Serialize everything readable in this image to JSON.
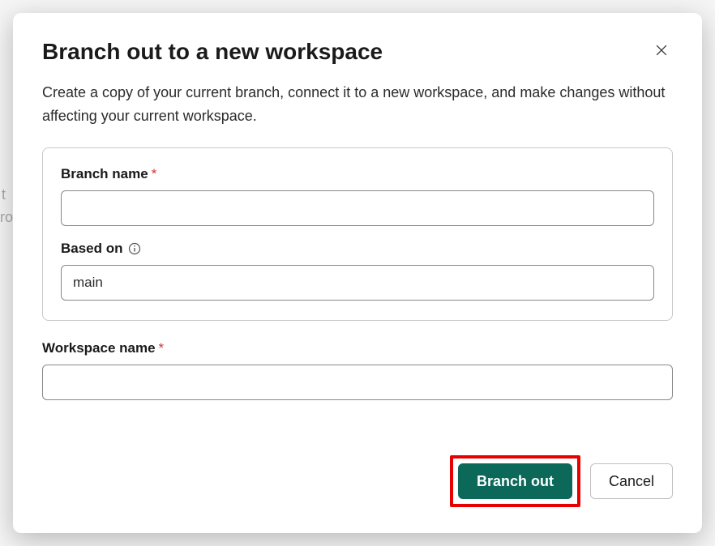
{
  "dialog": {
    "title": "Branch out to a new workspace",
    "description": "Create a copy of your current branch, connect it to a new workspace, and make changes without affecting your current workspace.",
    "fields": {
      "branch_name": {
        "label": "Branch name",
        "required_marker": "*",
        "value": ""
      },
      "based_on": {
        "label": "Based on",
        "value": "main"
      },
      "workspace_name": {
        "label": "Workspace name",
        "required_marker": "*",
        "value": ""
      }
    },
    "actions": {
      "primary_label": "Branch out",
      "secondary_label": "Cancel"
    }
  }
}
